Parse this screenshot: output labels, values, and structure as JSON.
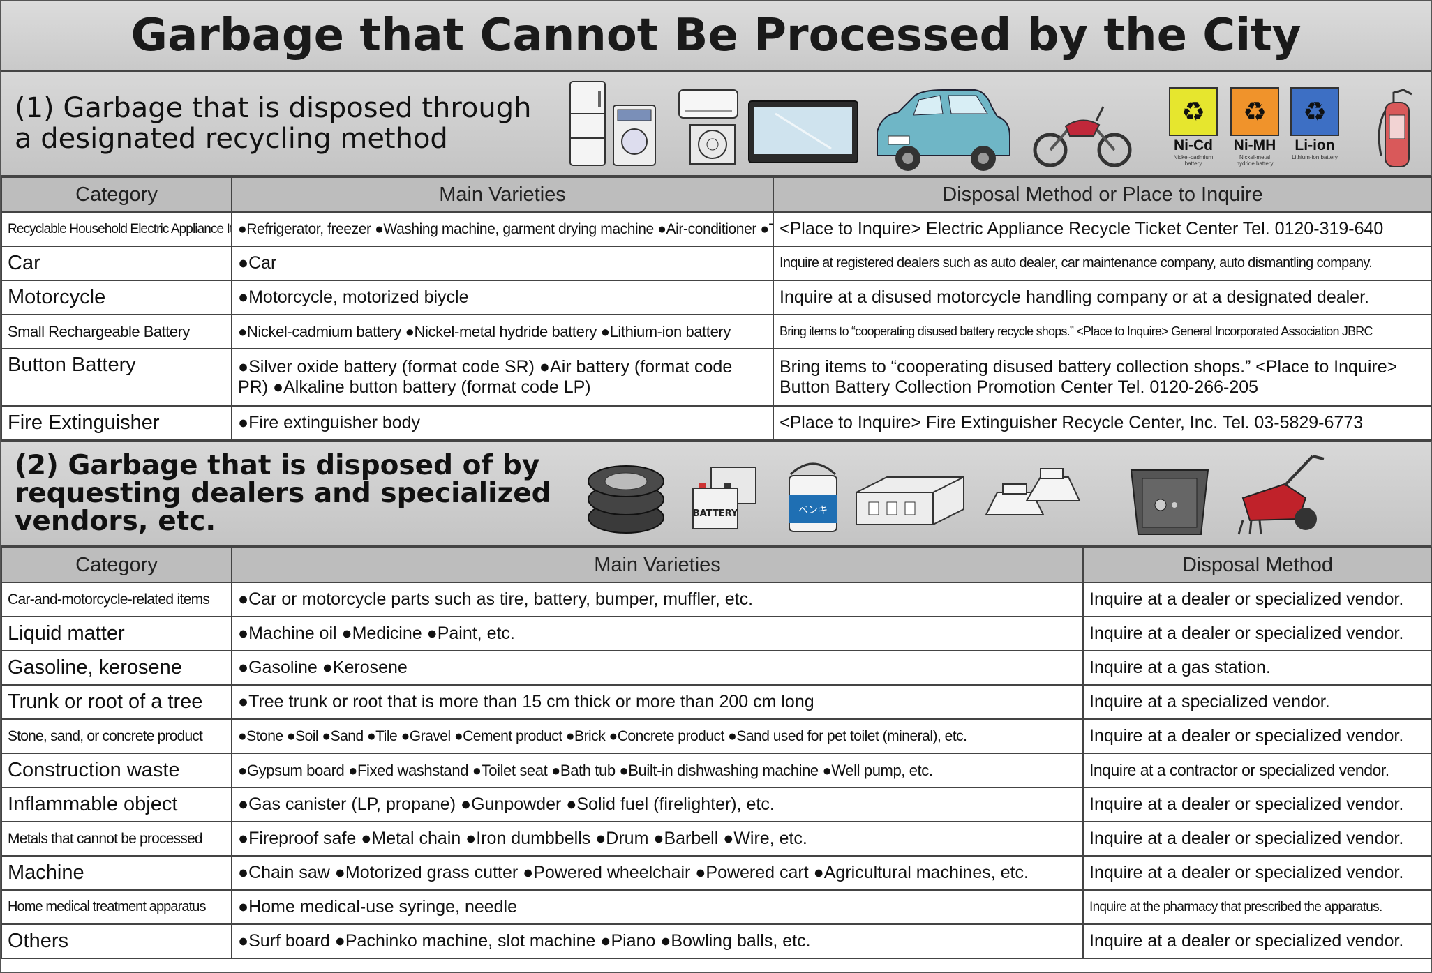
{
  "title": "Garbage that Cannot Be Processed by the City",
  "section1": {
    "heading_line1": "(1) Garbage that is disposed through",
    "heading_line2": "a designated recycling method",
    "batteries": [
      {
        "label": "Ni-Cd",
        "sub": "Nickel-cadmium battery",
        "color": "#e6e62e"
      },
      {
        "label": "Ni-MH",
        "sub": "Nickel-metal hydride battery",
        "color": "#f0932b"
      },
      {
        "label": "Li-ion",
        "sub": "Lithium-ion battery",
        "color": "#3d6fc4"
      }
    ],
    "headers": [
      "Category",
      "Main Varieties",
      "Disposal Method or Place to Inquire"
    ],
    "rows": [
      {
        "cat": "Recyclable Household Electric Appliance Items",
        "var": "●Refrigerator, freezer ●Washing machine, garment drying machine ●Air-conditioner ●TV set",
        "disp": "<Place to Inquire> Electric Appliance Recycle Ticket Center Tel. 0120-319-640"
      },
      {
        "cat": "Car",
        "var": "●Car",
        "disp": "Inquire at registered dealers such as auto dealer, car maintenance company, auto dismantling company."
      },
      {
        "cat": "Motorcycle",
        "var": "●Motorcycle, motorized biycle",
        "disp": "Inquire at a disused motorcycle handling company or at a designated dealer."
      },
      {
        "cat": "Small Rechargeable Battery",
        "var": "●Nickel-cadmium battery ●Nickel-metal hydride battery ●Lithium-ion battery",
        "disp": "Bring items to “cooperating disused battery recycle shops.” <Place to Inquire> General Incorporated Association JBRC"
      },
      {
        "cat": "Button Battery",
        "var": "●Silver oxide battery (format code SR) ●Air battery (format code PR) ●Alkaline button battery (format code LP)",
        "disp": "Bring items to “cooperating disused battery collection shops.” <Place to Inquire> Button Battery Collection Promotion Center Tel. 0120-266-205"
      },
      {
        "cat": "Fire Extinguisher",
        "var": "●Fire extinguisher body",
        "disp": "<Place to Inquire> Fire Extinguisher Recycle Center, Inc. Tel. 03-5829-6773"
      }
    ]
  },
  "section2": {
    "heading_line1": "(2) Garbage that is disposed of by",
    "heading_line2": "requesting dealers and specialized",
    "heading_line3": "vendors, etc.",
    "battery_label": "BATTERY",
    "paint_label": "ペンキ",
    "headers": [
      "Category",
      "Main Varieties",
      "Disposal Method"
    ],
    "rows": [
      {
        "cat": "Car-and-motorcycle-related items",
        "var": "●Car or motorcycle parts such as tire, battery, bumper, muffler, etc.",
        "disp": "Inquire at a dealer or specialized vendor."
      },
      {
        "cat": "Liquid matter",
        "var": "●Machine oil ●Medicine ●Paint, etc.",
        "disp": "Inquire at a dealer or specialized vendor."
      },
      {
        "cat": "Gasoline, kerosene",
        "var": "●Gasoline ●Kerosene",
        "disp": "Inquire at a gas station."
      },
      {
        "cat": "Trunk or root of a tree",
        "var": "●Tree trunk or root that is more than 15 cm thick or more than 200 cm long",
        "disp": "Inquire at a specialized vendor."
      },
      {
        "cat": "Stone, sand, or concrete product",
        "var": "●Stone ●Soil ●Sand ●Tile ●Gravel ●Cement product ●Brick ●Concrete product ●Sand used for pet toilet (mineral), etc.",
        "disp": "Inquire at a dealer or specialized vendor."
      },
      {
        "cat": "Construction waste",
        "var": "●Gypsum board ●Fixed washstand ●Toilet seat ●Bath tub ●Built-in dishwashing machine ●Well pump, etc.",
        "disp": "Inquire at a contractor or specialized vendor."
      },
      {
        "cat": "Inflammable object",
        "var": "●Gas canister (LP, propane) ●Gunpowder ●Solid fuel (firelighter), etc.",
        "disp": "Inquire at a dealer or specialized vendor."
      },
      {
        "cat": "Metals that cannot be processed",
        "var": "●Fireproof safe ●Metal chain ●Iron dumbbells ●Drum ●Barbell ●Wire, etc.",
        "disp": "Inquire at a dealer or specialized vendor."
      },
      {
        "cat": "Machine",
        "var": "●Chain saw ●Motorized grass cutter ●Powered wheelchair ●Powered cart ●Agricultural machines, etc.",
        "disp": "Inquire at a dealer or specialized vendor."
      },
      {
        "cat": "Home medical treatment apparatus",
        "var": "●Home medical-use syringe, needle",
        "disp": "Inquire at the pharmacy that prescribed the apparatus."
      },
      {
        "cat": "Others",
        "var": "●Surf board ●Pachinko machine, slot machine ●Piano ●Bowling balls, etc.",
        "disp": "Inquire at a dealer or specialized vendor."
      }
    ]
  }
}
